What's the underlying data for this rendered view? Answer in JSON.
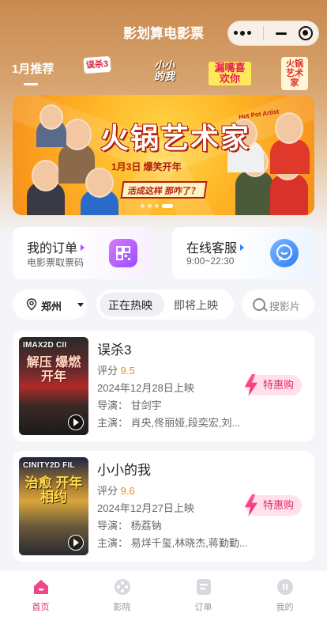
{
  "header": {
    "title": "影划算电影票"
  },
  "category_tabs": {
    "first": "1月推荐",
    "logos": [
      "误杀3",
      "小小的我",
      "漏嘴喜欢你",
      "火锅艺术家"
    ]
  },
  "banner": {
    "logo_small": "Hot Pot Artist",
    "title": "火锅艺术家",
    "subtitle": "1月3日  爆笑开年",
    "slogan": "活成这样  那咋了？"
  },
  "quick_cards": [
    {
      "title": "我的订单",
      "subtitle": "电影票取票码",
      "accent": "#a94bff"
    },
    {
      "title": "在线客服",
      "subtitle": "9:00~22:30",
      "accent": "#2f7cf6"
    }
  ],
  "filter": {
    "city": "郑州",
    "tabs": [
      "正在热映",
      "即将上映"
    ],
    "active_tab": 0,
    "search_placeholder": "搜影片"
  },
  "movies": [
    {
      "poster_tag": "IMAX2D CII",
      "poster_art": "解压 爆燃开年",
      "title": "误杀3",
      "score_label": "评分",
      "score": "9.5",
      "release": "2024年12月28日上映",
      "director_label": "导演：",
      "director": "甘剑宇",
      "cast_label": "主演：",
      "cast": "肖央,佟丽娅,段奕宏,刘...",
      "buy_label": "特惠购"
    },
    {
      "poster_tag": "CINITY2D FIL",
      "poster_art": "治愈 开年相约",
      "title": "小小的我",
      "score_label": "评分",
      "score": "9.6",
      "release": "2024年12月27日上映",
      "director_label": "导演：",
      "director": "杨荔钠",
      "cast_label": "主演：",
      "cast": "易烊千玺,林晓杰,蒋勤勤...",
      "buy_label": "特惠购"
    }
  ],
  "tabbar": {
    "items": [
      "首页",
      "影院",
      "订单",
      "我的"
    ],
    "active": 0,
    "active_color": "#e62a6a"
  }
}
